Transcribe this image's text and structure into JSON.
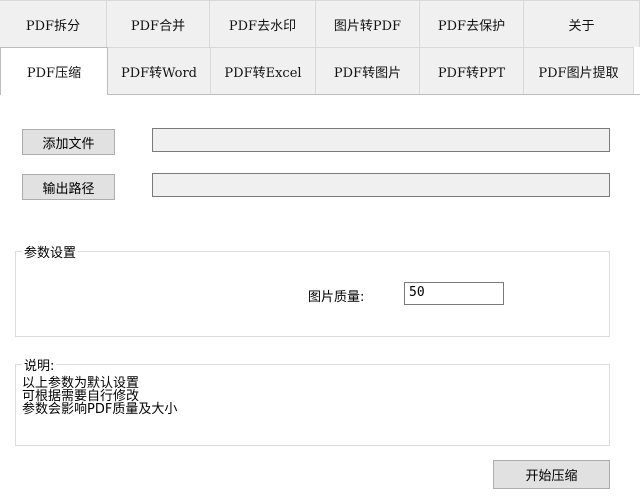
{
  "tabs": {
    "row1": [
      "PDF拆分",
      "PDF合并",
      "PDF去水印",
      "图片转PDF",
      "PDF去保护",
      "关于"
    ],
    "row2": [
      "PDF压缩",
      "PDF转Word",
      "PDF转Excel",
      "PDF转图片",
      "PDF转PPT",
      "PDF图片提取"
    ],
    "active": "PDF压缩"
  },
  "buttons": {
    "add_file": "添加文件",
    "output_path": "输出路径",
    "start": "开始压缩"
  },
  "params": {
    "legend": "参数设置",
    "quality_label": "图片质量:",
    "quality_value": "50"
  },
  "notes": {
    "legend": "说明:",
    "lines": [
      "以上参数为默认设置",
      "可根据需要自行修改",
      "参数会影响PDF质量及大小"
    ]
  }
}
